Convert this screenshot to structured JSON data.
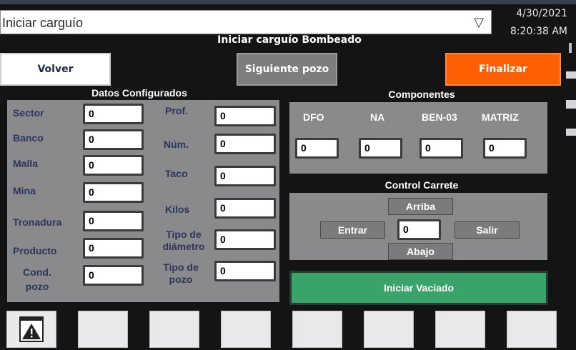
{
  "screen_select": {
    "value": "Iniciar carguío"
  },
  "datetime": {
    "date": "4/30/2021",
    "time": "8:20:38 AM"
  },
  "title": "Iniciar carguío Bombeado",
  "buttons": {
    "volver": "Volver",
    "siguiente": "Siguiente pozo",
    "finalizar": "Finalizar",
    "iniciar_vaciado": "Iniciar Vaciado"
  },
  "datos": {
    "heading": "Datos Configurados",
    "left": [
      {
        "label": "Sector",
        "value": "0"
      },
      {
        "label": "Banco",
        "value": "0"
      },
      {
        "label": "Malla",
        "value": "0"
      },
      {
        "label": "Mina",
        "value": "0"
      },
      {
        "label": "Tronadura",
        "value": "0"
      },
      {
        "label": "Producto",
        "value": "0"
      },
      {
        "label": "Cond. pozo",
        "value": "0"
      }
    ],
    "right": [
      {
        "label": "Prof.",
        "value": "0"
      },
      {
        "label": "Núm.",
        "value": "0"
      },
      {
        "label": "Taco",
        "value": "0"
      },
      {
        "label": "Kilos",
        "value": "0"
      },
      {
        "label": "Tipo de diámetro",
        "value": "0"
      },
      {
        "label": "Tipo de pozo",
        "value": "0"
      }
    ]
  },
  "componentes": {
    "heading": "Componentes",
    "items": [
      {
        "label": "DFO",
        "value": "0"
      },
      {
        "label": "NA",
        "value": "0"
      },
      {
        "label": "BEN-03",
        "value": "0"
      },
      {
        "label": "MATRIZ",
        "value": "0"
      }
    ]
  },
  "control": {
    "heading": "Control Carrete",
    "arriba": "Arriba",
    "abajo": "Abajo",
    "entrar": "Entrar",
    "salir": "Salir",
    "value": "0"
  },
  "function_keys": [
    "warning-icon",
    "",
    "",
    "",
    "",
    "",
    "",
    ""
  ]
}
